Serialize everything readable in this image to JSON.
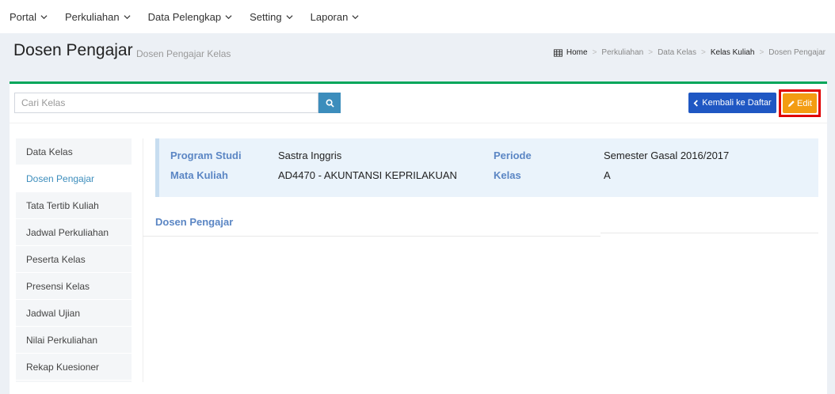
{
  "nav": {
    "items": [
      {
        "label": "Portal"
      },
      {
        "label": "Perkuliahan"
      },
      {
        "label": "Data Pelengkap"
      },
      {
        "label": "Setting"
      },
      {
        "label": "Laporan"
      }
    ]
  },
  "header": {
    "title": "Dosen Pengajar",
    "subtitle": "Dosen Pengajar Kelas",
    "breadcrumb": [
      "Home",
      "Perkuliahan",
      "Data Kelas",
      "Kelas Kuliah",
      "Dosen Pengajar"
    ]
  },
  "toolbar": {
    "search_placeholder": "Cari Kelas",
    "back_label": "Kembali ke Daftar",
    "edit_label": "Edit"
  },
  "sidemenu": {
    "items": [
      {
        "label": "Data Kelas"
      },
      {
        "label": "Dosen Pengajar"
      },
      {
        "label": "Tata Tertib Kuliah"
      },
      {
        "label": "Jadwal Perkuliahan"
      },
      {
        "label": "Peserta Kelas"
      },
      {
        "label": "Presensi Kelas"
      },
      {
        "label": "Jadwal Ujian"
      },
      {
        "label": "Nilai Perkuliahan"
      },
      {
        "label": "Rekap Kuesioner"
      }
    ],
    "active": "Dosen Pengajar"
  },
  "info": {
    "program_studi_label": "Program Studi",
    "program_studi_value": "Sastra Inggris",
    "mata_kuliah_label": "Mata Kuliah",
    "mata_kuliah_value": "AD4470 - AKUNTANSI KEPRILAKUAN",
    "periode_label": "Periode",
    "periode_value": "Semester Gasal 2016/2017",
    "kelas_label": "Kelas",
    "kelas_value": "A"
  },
  "section": {
    "title": "Dosen Pengajar"
  },
  "colors": {
    "accent_green": "#00a65a",
    "primary_blue": "#1f57c3",
    "search_blue": "#3c8dbc",
    "edit_orange": "#f39c12",
    "highlight_red": "#e00000",
    "label_blue": "#5b86c4"
  }
}
